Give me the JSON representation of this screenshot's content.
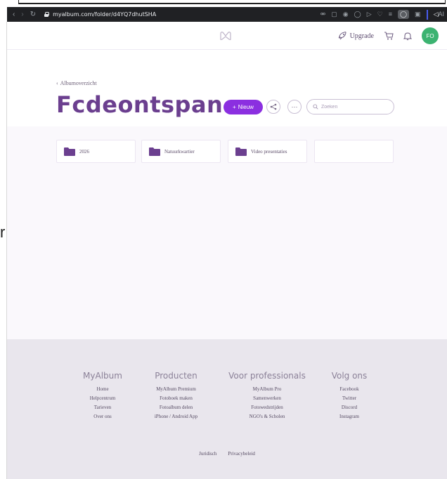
{
  "browser": {
    "url": "myalbum.com/folder/d4YQ7dhutSHA",
    "ai_label": "AI"
  },
  "header": {
    "upgrade_label": "Upgrade",
    "avatar_initials": "FO"
  },
  "page": {
    "breadcrumb": "Albumoverzicht",
    "title": "Fcdeontspan...",
    "new_button_label": "Nieuw",
    "search_placeholder": "Zoeken"
  },
  "folders": [
    {
      "label": "2026"
    },
    {
      "label": "Natuurkwartier"
    },
    {
      "label": "Video presentaties"
    },
    {
      "label": ""
    }
  ],
  "stray_text": "r",
  "footer": {
    "columns": [
      {
        "heading": "MyAlbum",
        "links": [
          "Home",
          "Helpcentrum",
          "Tarieven",
          "Over ons"
        ]
      },
      {
        "heading": "Producten",
        "links": [
          "MyAlbum Premium",
          "Fotoboek maken",
          "Fotoalbum delen",
          "iPhone / Android App"
        ]
      },
      {
        "heading": "Voor professionals",
        "links": [
          "MyAlbum Pro",
          "Samenwerken",
          "Fotowedstrijden",
          "NGO's & Scholen"
        ]
      },
      {
        "heading": "Volg ons",
        "links": [
          "Facebook",
          "Twitter",
          "Discord",
          "Instagram"
        ]
      }
    ],
    "bottom_links": [
      "Juridisch",
      "Privacybeleid"
    ]
  },
  "colors": {
    "brand_purple": "#6b3f8f",
    "button_purple": "#8b2fe0",
    "avatar_green": "#3cb371",
    "footer_bg": "#e9e6ed",
    "chrome_bg": "#202124"
  }
}
